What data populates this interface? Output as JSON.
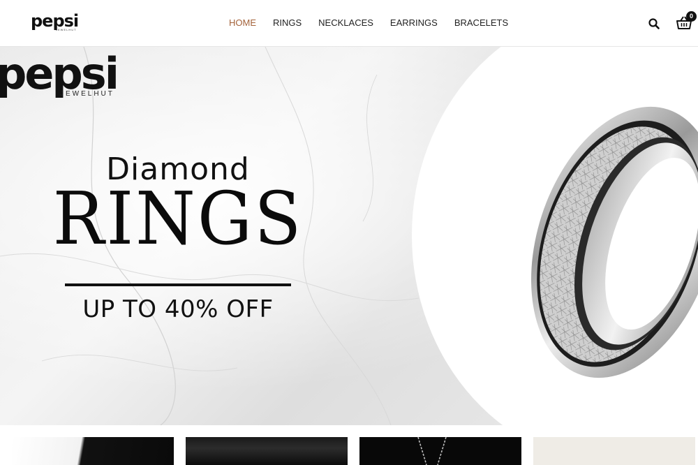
{
  "brand": {
    "name": "pepsi",
    "tagline": "JEWELHUT"
  },
  "nav": {
    "items": [
      {
        "label": "HOME",
        "active": true
      },
      {
        "label": "RINGS",
        "active": false
      },
      {
        "label": "NECKLACES",
        "active": false
      },
      {
        "label": "EARRINGS",
        "active": false
      },
      {
        "label": "BRACELETS",
        "active": false
      }
    ],
    "active_color": "#a4633b"
  },
  "header_icons": {
    "search": "search-icon",
    "cart": "basket-icon",
    "cart_count": "0"
  },
  "hero": {
    "logo_text": "pepsi",
    "logo_sub": "JEWELHUT",
    "line1": "Diamond",
    "line2": "RINGS",
    "offer": "UP TO 40% OFF",
    "image": "silver-meteorite-ring"
  },
  "categories": [
    {
      "image": "tile-white-black"
    },
    {
      "image": "tile-dark-gradient"
    },
    {
      "image": "tile-necklace-chain"
    },
    {
      "image": "tile-cream"
    }
  ]
}
